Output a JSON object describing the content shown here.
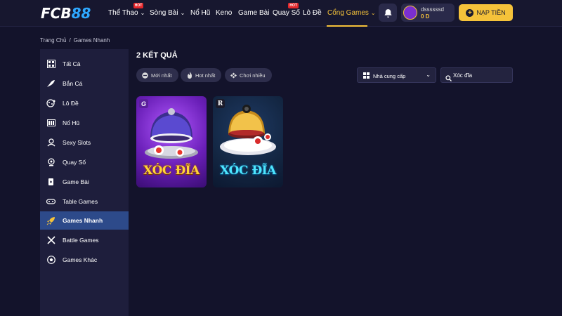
{
  "header": {
    "logo": {
      "part1": "FCB",
      "part2": "88"
    },
    "nav": [
      {
        "label": "Thể Thao",
        "hot": "HOT"
      },
      {
        "label": "Sòng Bài"
      },
      {
        "label": "Nổ Hũ"
      },
      {
        "label": "Keno"
      },
      {
        "label": "Game Bài"
      },
      {
        "label": "Quay Số",
        "hot": "HOT"
      },
      {
        "label": "Lô Đề"
      },
      {
        "label": "Cổng Games"
      }
    ],
    "user": {
      "name": "dssssssd",
      "balance": "0 D"
    },
    "deposit_label": "NẠP TIỀN"
  },
  "breadcrumb": {
    "home": "Trang Chủ",
    "separator": "/",
    "current": "Games Nhanh"
  },
  "sidebar": {
    "items": [
      {
        "label": "Tất Cả",
        "icon": "grid-icon"
      },
      {
        "label": "Bắn Cá",
        "icon": "fish-icon"
      },
      {
        "label": "Lô Đề",
        "icon": "lottery-balls-icon"
      },
      {
        "label": "Nổ Hũ",
        "icon": "slot-machine-icon"
      },
      {
        "label": "Sexy Slots",
        "icon": "casino-chip-icon"
      },
      {
        "label": "Quay Số",
        "icon": "lottery-machine-icon"
      },
      {
        "label": "Game Bài",
        "icon": "cards-icon"
      },
      {
        "label": "Table Games",
        "icon": "gamepad-icon"
      },
      {
        "label": "Games Nhanh",
        "icon": "rocket-icon"
      },
      {
        "label": "Battle Games",
        "icon": "crossed-swords-icon"
      },
      {
        "label": "Games Khác",
        "icon": "soccer-ball-icon"
      }
    ],
    "active_index": 8
  },
  "main": {
    "results_label": "2 KẾT QUẢ",
    "filters": [
      {
        "label": "Mới nhất",
        "icon": "new-icon"
      },
      {
        "label": "Hot nhất",
        "icon": "fire-icon"
      },
      {
        "label": "Chơi nhiều",
        "icon": "gamepad-icon"
      }
    ],
    "provider_label": "Nhà cung cấp",
    "search_value": "Xóc đĩa",
    "games": [
      {
        "title": "XÓC ĐĨA",
        "badge": "G"
      },
      {
        "title": "XÓC ĐĨA",
        "badge": "R"
      }
    ]
  },
  "colors": {
    "accent": "#f5c23a",
    "background": "#13132b",
    "sidebar": "#1e1e3c",
    "active_item": "#2d4a8a",
    "hot_badge": "#e3262a"
  }
}
